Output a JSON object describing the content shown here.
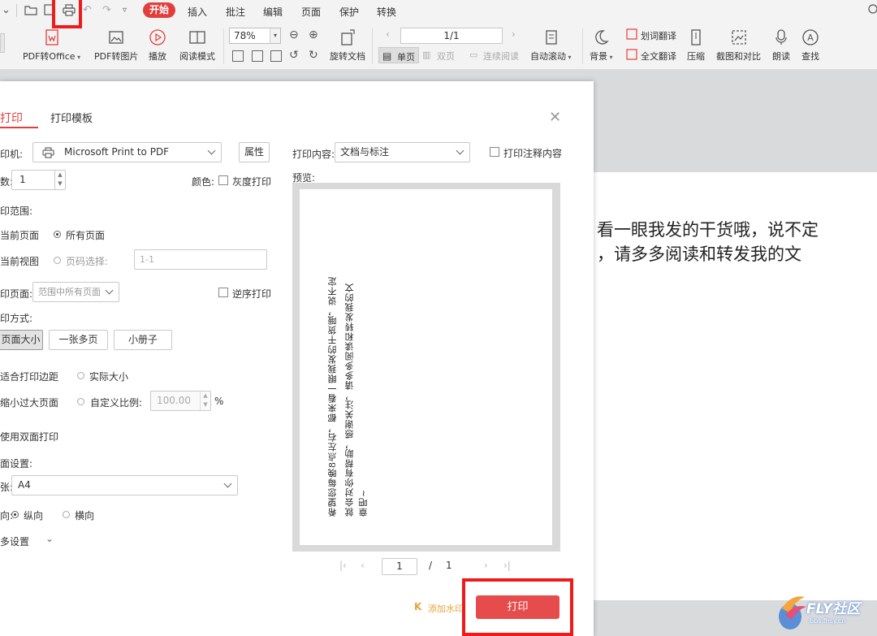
{
  "menubar": {
    "start_label": "开始",
    "items": [
      "插入",
      "批注",
      "编辑",
      "页面",
      "保护",
      "转换"
    ]
  },
  "toolbar": {
    "pdf_to_office": "PDF转Office",
    "pdf_to_image": "PDF转图片",
    "play": "播放",
    "read_mode": "阅读模式",
    "zoom": "78%",
    "rotate_doc": "旋转文档",
    "page_indicator": "1/1",
    "single_page": "单页",
    "double_page": "双页",
    "continuous_read": "连续阅读",
    "auto_scroll": "自动滚动",
    "word_translate": "划词翻译",
    "background": "背景",
    "full_translate": "全文翻译",
    "compress": "压缩",
    "screenshot_compare": "截图和对比",
    "read_aloud": "朗读",
    "find": "查找"
  },
  "document": {
    "line1": "看一眼我发的干货哦，说不定",
    "line2": "，请多多阅读和转发我的文"
  },
  "dialog": {
    "tab_print": "打印",
    "tab_template": "打印模板",
    "printer_label": "印机:",
    "printer_value": "Microsoft Print to PDF",
    "properties": "属性",
    "copies_label": "数:",
    "copies_value": "1",
    "color_label": "颜色:",
    "grayscale": "灰度打印",
    "range_label": "印范围:",
    "current_page": "当前页面",
    "all_pages": "所有页面",
    "current_view": "当前视图",
    "page_select": "页码选择:",
    "page_select_placeholder": "1-1",
    "sub_pages_label": "印页面:",
    "sub_pages_value": "范围中所有页面",
    "reverse_print": "逆序打印",
    "mode_label": "印方式:",
    "mode_page_size": "页面大小",
    "mode_multi": "一张多页",
    "mode_booklet": "小册子",
    "fit_margin": "适合打印边距",
    "actual_size": "实际大小",
    "shrink_large": "缩小过大页面",
    "custom_scale": "自定义比例:",
    "scale_value": "100.00",
    "percent": "%",
    "duplex": "使用双面打印",
    "page_setup_label": "面设置:",
    "paper_label": "张:",
    "paper_value": "A4",
    "orientation_label": "向:",
    "portrait": "纵向",
    "landscape": "横向",
    "more_settings": "多设置",
    "print_content_label": "打印内容:",
    "print_content_value": "文档与标注",
    "print_annotations": "打印注释内容",
    "preview_label": "预览:",
    "page_current": "1",
    "page_sep": "/",
    "page_total": "1",
    "add_watermark": "添加水印",
    "print_button": "打印"
  },
  "preview_text": {
    "col1": "希望您每晚8点左右，都来看一眼我发的干货哦，说不定",
    "col2": "就会对你有帮助，感谢关注，请多多阅读和转发我的文",
    "col3": "章吧~"
  },
  "watermark": {
    "brand": "FLY社区",
    "url": "bbs.fhsy.cn"
  }
}
